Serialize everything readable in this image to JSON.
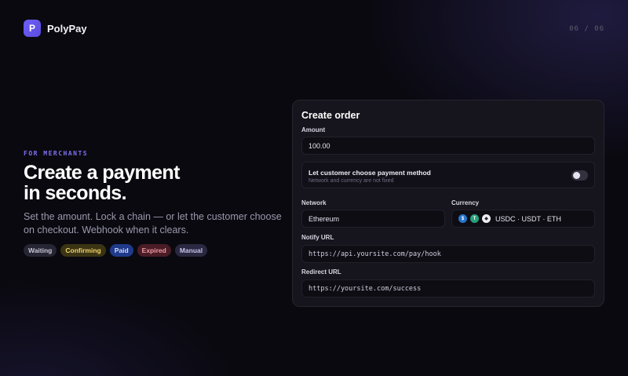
{
  "brand": {
    "logo_letter": "P",
    "name": "PolyPay"
  },
  "pager": "06 / 06",
  "hero": {
    "eyebrow": "FOR MERCHANTS",
    "headline_line1": "Create a payment",
    "headline_line2": "in seconds.",
    "subtitle": "Set the amount. Lock a chain — or let the customer choose on checkout. Webhook when it clears.",
    "status_chips": [
      "Waiting",
      "Confirming",
      "Paid",
      "Expired",
      "Manual"
    ]
  },
  "form": {
    "title": "Create order",
    "amount": {
      "label": "Amount",
      "value": "100.00"
    },
    "customer_choice": {
      "title": "Let customer choose payment method",
      "hint": "Network and currency are not fixed",
      "enabled": false
    },
    "network": {
      "label": "Network",
      "value": "Ethereum"
    },
    "currency": {
      "label": "Currency",
      "value": "USDC · USDT · ETH",
      "icons": [
        "usdc-icon",
        "usdt-icon",
        "eth-icon"
      ]
    },
    "notify_url": {
      "label": "Notify URL",
      "value": "https://api.yoursite.com/pay/hook"
    },
    "redirect_url": {
      "label": "Redirect URL",
      "value": "https://yoursite.com/success"
    }
  },
  "colors": {
    "background": "#0a0910",
    "accent": "#6d5ef5",
    "card": "#16151d"
  }
}
